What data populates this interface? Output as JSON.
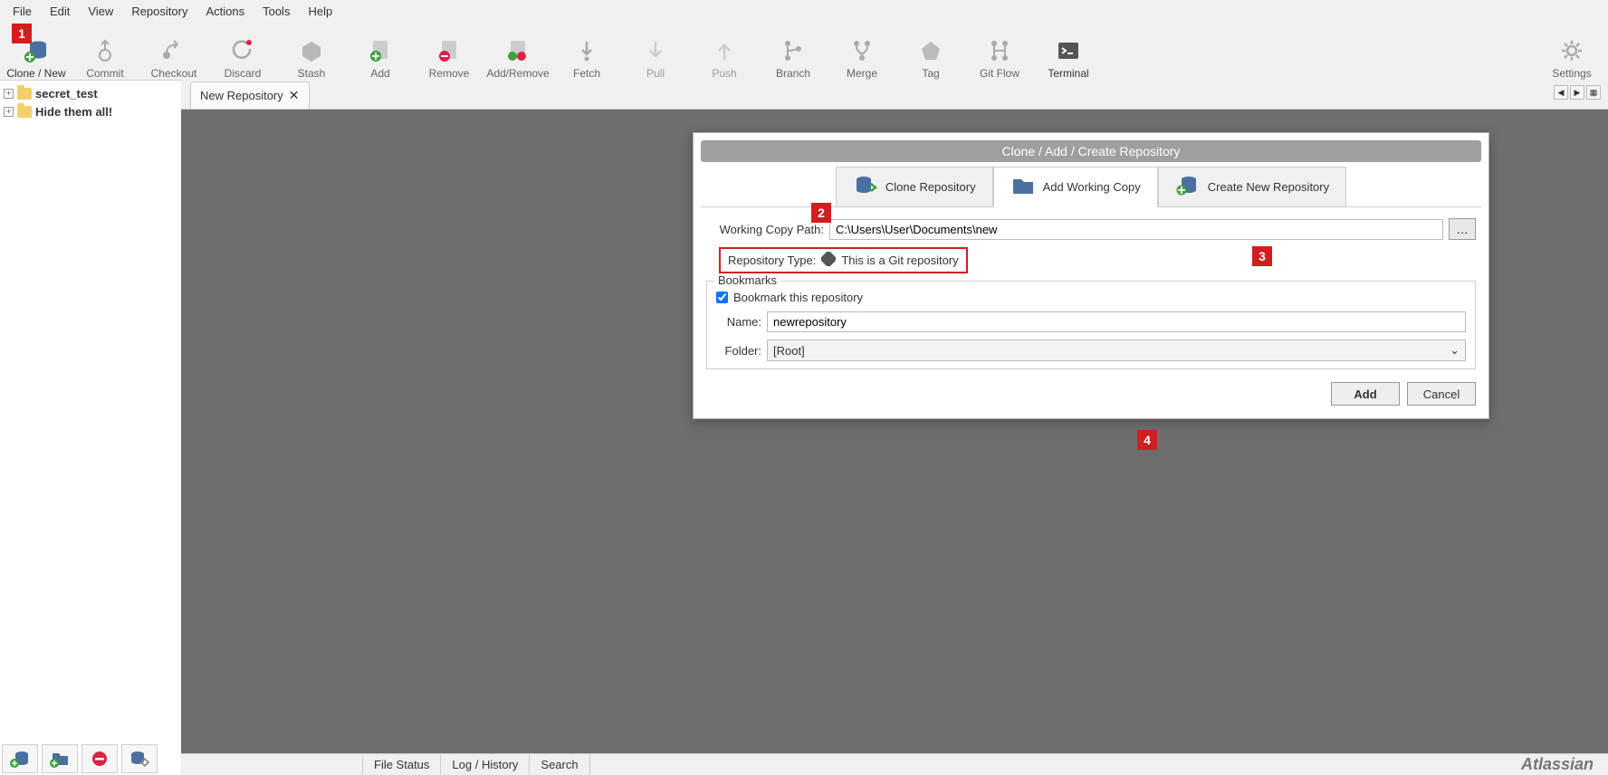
{
  "menu": {
    "file": "File",
    "edit": "Edit",
    "view": "View",
    "repository": "Repository",
    "actions": "Actions",
    "tools": "Tools",
    "help": "Help"
  },
  "toolbar": {
    "clone": "Clone / New",
    "commit": "Commit",
    "checkout": "Checkout",
    "discard": "Discard",
    "stash": "Stash",
    "add": "Add",
    "remove": "Remove",
    "addremove": "Add/Remove",
    "fetch": "Fetch",
    "pull": "Pull",
    "push": "Push",
    "branch": "Branch",
    "merge": "Merge",
    "tag": "Tag",
    "gitflow": "Git Flow",
    "terminal": "Terminal",
    "settings": "Settings"
  },
  "sidebar": {
    "items": [
      "secret_test",
      "Hide them all!"
    ]
  },
  "tab": {
    "title": "New Repository"
  },
  "dialog": {
    "title": "Clone  / Add / Create Repository",
    "tabs": {
      "clone": "Clone Repository",
      "add": "Add Working Copy",
      "create": "Create New Repository"
    },
    "wcp_label": "Working Copy Path:",
    "wcp_value": "C:\\Users\\User\\Documents\\new",
    "browse": "…",
    "repo_type_label": "Repository Type:",
    "repo_type_value": "This is a Git repository",
    "bookmarks_legend": "Bookmarks",
    "bookmark_cb": "Bookmark this repository",
    "name_label": "Name:",
    "name_value": "newrepository",
    "folder_label": "Folder:",
    "folder_value": "[Root]",
    "add_btn": "Add",
    "cancel_btn": "Cancel"
  },
  "status": {
    "file": "File Status",
    "log": "Log / History",
    "search": "Search",
    "brand": "Atlassian"
  },
  "callouts": {
    "c1": "1",
    "c2": "2",
    "c3": "3",
    "c4": "4"
  }
}
